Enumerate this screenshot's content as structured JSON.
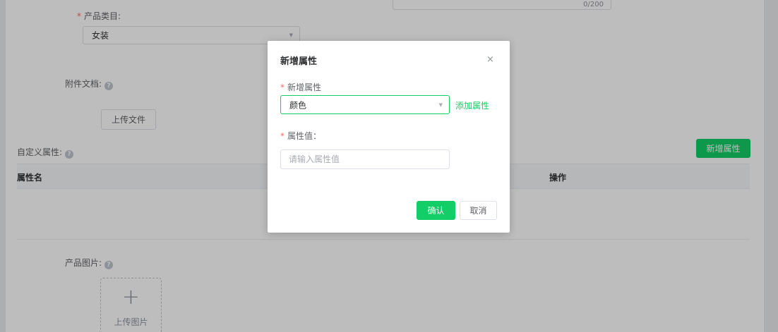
{
  "form": {
    "description_counter": "0/200",
    "category": {
      "label": "产品类目:",
      "value": "女装"
    },
    "attachment": {
      "label": "附件文档:",
      "upload_button": "上传文件"
    },
    "custom_attrs": {
      "label": "自定义属性:",
      "add_button": "新增属性",
      "columns": {
        "name": "属性名",
        "action": "操作"
      }
    },
    "product_image": {
      "label": "产品图片:",
      "upload_text": "上传图片"
    }
  },
  "dialog": {
    "title": "新增属性",
    "close_label": "×",
    "attr_label": "新增属性",
    "attr_value": "颜色",
    "add_attr_link": "添加属性",
    "value_label": "属性值：",
    "value_placeholder": "请输入属性值",
    "confirm_button": "确认",
    "cancel_button": "取消"
  },
  "icons": {
    "help": "question-circle-icon",
    "arrow": "caret-down-icon",
    "plus": "plus-icon",
    "close": "close-icon"
  },
  "colors": {
    "primary": "#13ce66",
    "required": "#f56c6c",
    "mask": "rgba(0,0,0,0.26)"
  }
}
